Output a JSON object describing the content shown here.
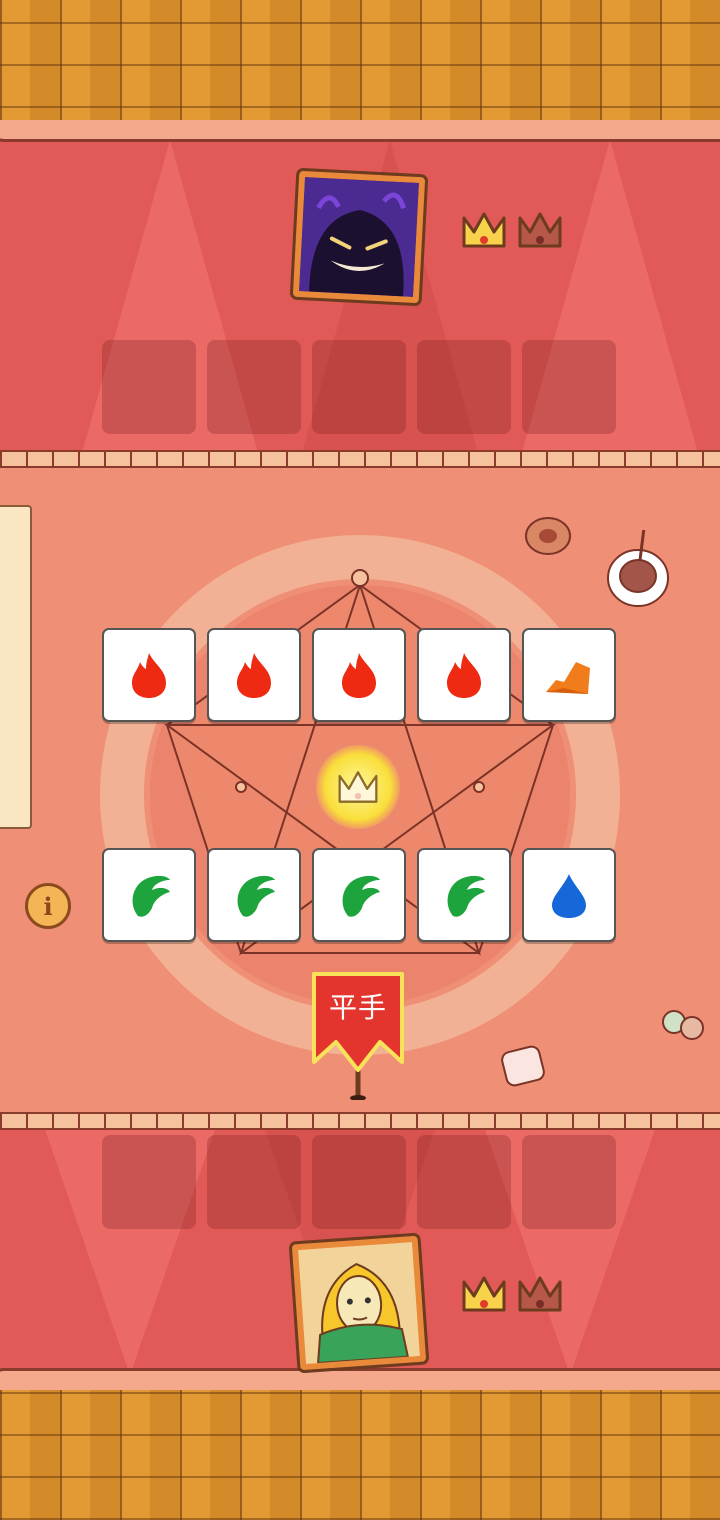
{
  "opponent": {
    "avatar_icon": "shadow-monster-icon",
    "crowns_won": 1,
    "crowns_total": 2
  },
  "player": {
    "avatar_icon": "blonde-character-icon",
    "crowns_won": 1,
    "crowns_total": 2
  },
  "opponent_cards": [
    {
      "element": "fire",
      "icon": "fire-icon",
      "color": "#ee2b12"
    },
    {
      "element": "fire",
      "icon": "fire-icon",
      "color": "#ee2b12"
    },
    {
      "element": "fire",
      "icon": "fire-icon",
      "color": "#ee2b12"
    },
    {
      "element": "fire",
      "icon": "fire-icon",
      "color": "#ee2b12"
    },
    {
      "element": "earth",
      "icon": "rock-icon",
      "color": "#f07c1c"
    }
  ],
  "player_cards": [
    {
      "element": "leaf",
      "icon": "leaf-icon",
      "color": "#1ea43c"
    },
    {
      "element": "leaf",
      "icon": "leaf-icon",
      "color": "#1ea43c"
    },
    {
      "element": "leaf",
      "icon": "leaf-icon",
      "color": "#1ea43c"
    },
    {
      "element": "leaf",
      "icon": "leaf-icon",
      "color": "#1ea43c"
    },
    {
      "element": "water",
      "icon": "water-drop-icon",
      "color": "#1668d8"
    }
  ],
  "result_banner": {
    "label": "平手"
  },
  "center_icon": "crown-icon",
  "info_button": {
    "icon": "info-icon",
    "label": "i"
  },
  "colors": {
    "rug": "#e15a57",
    "table": "#ef8f76",
    "crown_won": "#f7d24a",
    "crown_lost": "#b5584a"
  }
}
